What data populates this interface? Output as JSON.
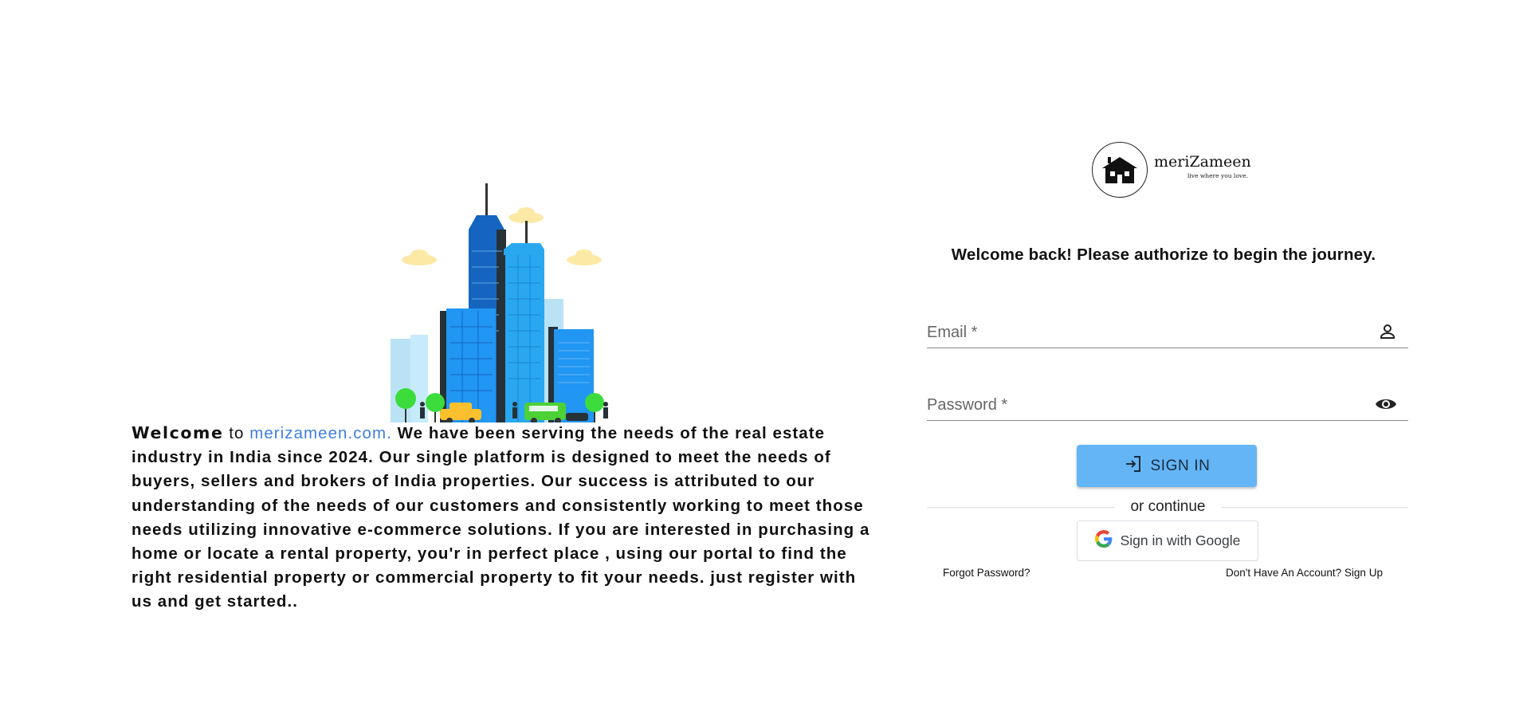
{
  "intro": {
    "welcome": "Welcome",
    "to": "to",
    "site": "merizameen.com.",
    "body": "We have been serving the needs of the real estate industry in India since 2024. Our single platform is designed to meet the needs of buyers, sellers and brokers of India properties. Our success is attributed to our understanding of the needs of our customers and consistently working to meet those needs utilizing innovative e-commerce solutions. If you are interested in purchasing a home or locate a rental property, you'r in perfect place , using our portal to find the right residential property or commercial property to fit your needs. just register with us and get started.."
  },
  "brand": {
    "name": "meriZameen",
    "tagline": "live where you love."
  },
  "login": {
    "headline": "Welcome back! Please authorize to begin the journey.",
    "email_label": "Email *",
    "password_label": "Password *",
    "signin_label": "SIGN IN",
    "divider_text": "or continue",
    "google_label": "Sign in with Google",
    "forgot_label": "Forgot Password?",
    "signup_label": "Don't Have An Account? Sign Up"
  },
  "icons": {
    "email": "person-icon",
    "password": "eye-icon",
    "signin": "login-icon",
    "google": "google-icon"
  },
  "colors": {
    "accent_button": "#64b5f6",
    "link": "#3f7fe0"
  }
}
